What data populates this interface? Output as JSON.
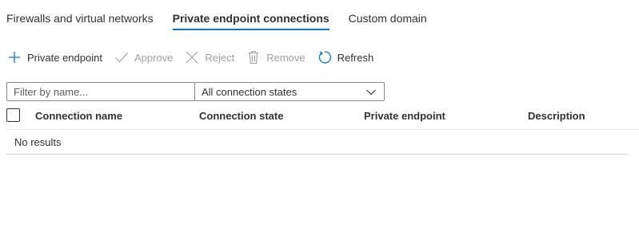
{
  "tabs": [
    {
      "label": "Firewalls and virtual networks",
      "active": false
    },
    {
      "label": "Private endpoint connections",
      "active": true
    },
    {
      "label": "Custom domain",
      "active": false
    }
  ],
  "toolbar": {
    "add_label": "Private endpoint",
    "approve_label": "Approve",
    "reject_label": "Reject",
    "remove_label": "Remove",
    "refresh_label": "Refresh"
  },
  "filter": {
    "placeholder": "Filter by name...",
    "value": ""
  },
  "state_select": {
    "selected": "All connection states"
  },
  "table": {
    "columns": [
      "Connection name",
      "Connection state",
      "Private endpoint",
      "Description"
    ],
    "empty_text": "No results"
  },
  "colors": {
    "accent": "#0078d4",
    "disabled": "#a19f9d"
  }
}
